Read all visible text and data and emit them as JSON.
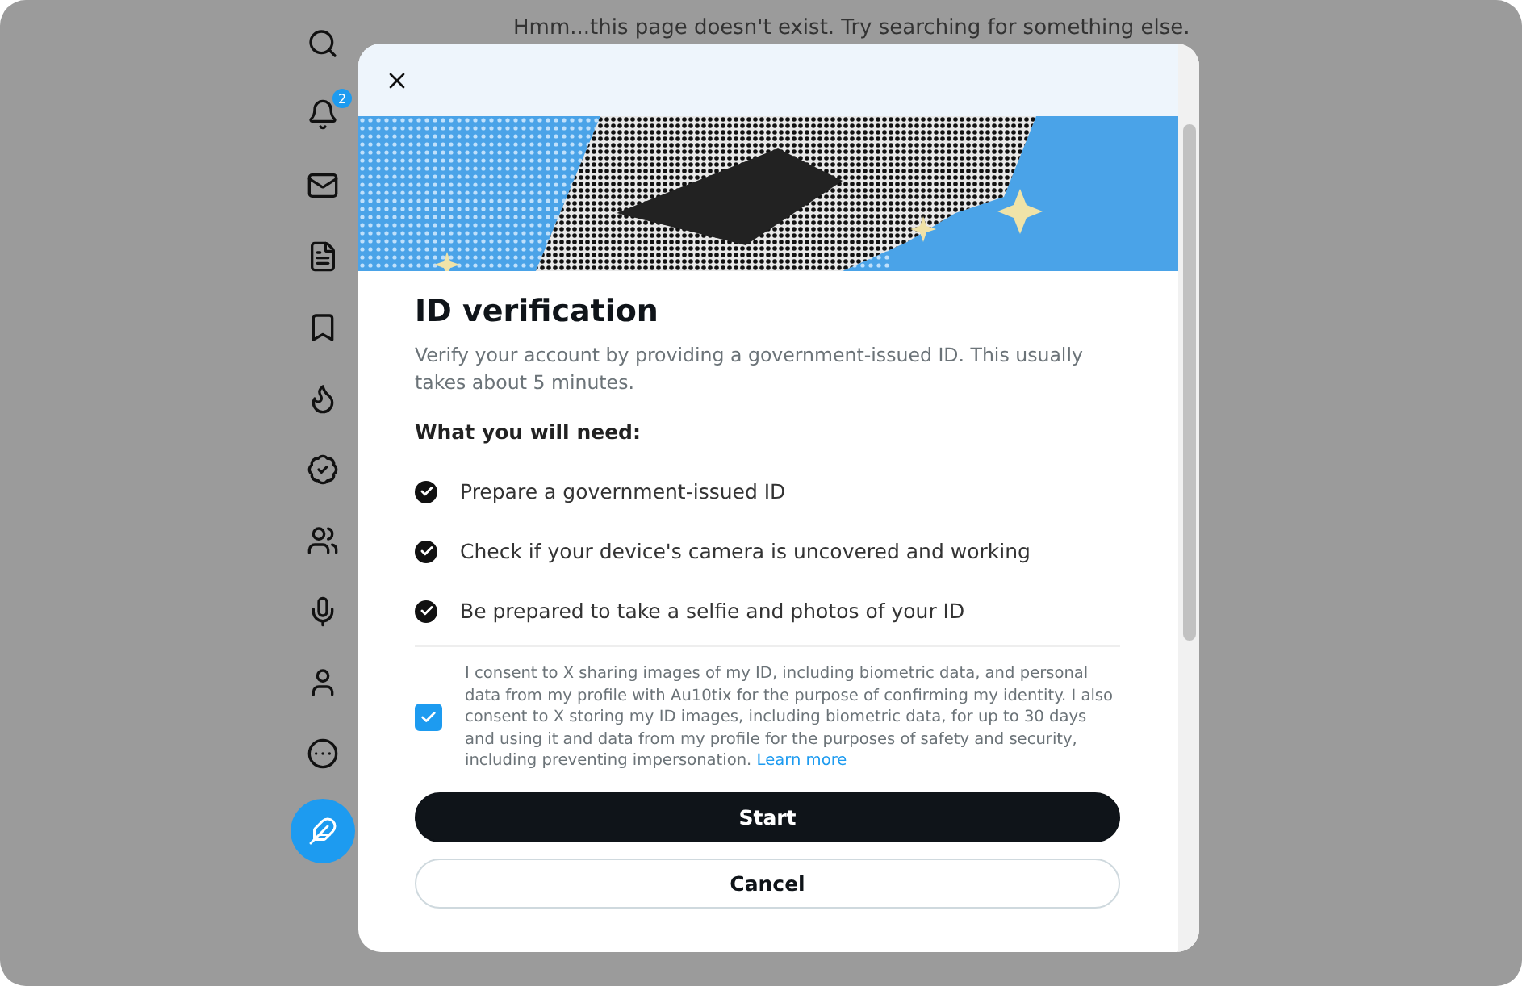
{
  "background": {
    "message": "Hmm...this page doesn't exist. Try searching for something else."
  },
  "sidebar": {
    "notification_badge": "2"
  },
  "dialog": {
    "title": "ID verification",
    "description": "Verify your account by providing a government-issued ID. This usually takes about 5 minutes.",
    "needs_heading": "What you will need:",
    "needs": [
      "Prepare a government-issued ID",
      "Check if your device's camera is uncovered and working",
      "Be prepared to take a selfie and photos of your ID"
    ],
    "consent": {
      "checked": true,
      "text": "I consent to X sharing images of my ID, including biometric data, and personal data from my profile with Au10tix for the purpose of confirming my identity. I also consent to X storing my ID images, including biometric data, for up to 30 days and using it and data from my profile for the purposes of safety and security, including preventing impersonation.",
      "link": "Learn more"
    },
    "buttons": [
      {
        "label": "Start",
        "kind": "primary"
      },
      {
        "label": "Cancel",
        "kind": "secondary"
      }
    ]
  }
}
